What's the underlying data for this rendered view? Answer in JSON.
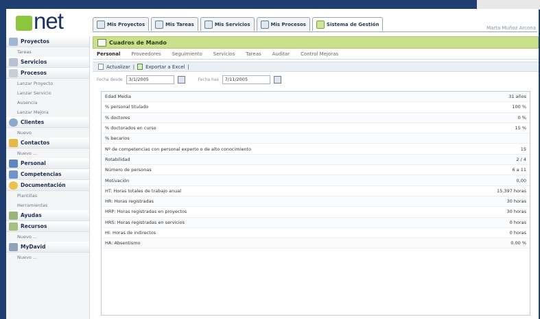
{
  "app": {
    "logo_text": "net",
    "user": "Marta Muñoz Arcona"
  },
  "tabs": [
    {
      "label": "Mis Proyectos"
    },
    {
      "label": "Mis Tareas"
    },
    {
      "label": "Mis Servicios"
    },
    {
      "label": "Mis Procesos"
    },
    {
      "label": "Sistema de Gestión"
    }
  ],
  "sidebar": {
    "sections": [
      {
        "label": "Proyectos",
        "links": [
          "Tareas"
        ]
      },
      {
        "label": "Servicios",
        "links": []
      },
      {
        "label": "Procesos",
        "links": [
          "Lanzar Proyecto",
          "Lanzar Servicio",
          "Ausencia",
          "Lanzar Mejora"
        ]
      },
      {
        "label": "Clientes",
        "links": [
          "Nuevo"
        ]
      },
      {
        "label": "Contactos",
        "links": [
          "Nuevo ..."
        ]
      },
      {
        "label": "Personal",
        "links": []
      },
      {
        "label": "Competencias",
        "links": []
      },
      {
        "label": "Documentación",
        "links": [
          "Plantillas",
          "Herramientas"
        ]
      },
      {
        "label": "Ayudas",
        "links": []
      },
      {
        "label": "Recursos",
        "links": [
          "Nuevo ..."
        ]
      },
      {
        "label": "MyDavid",
        "links": [
          "Nuevo ..."
        ]
      }
    ]
  },
  "panel": {
    "title": "Cuadros de Mando"
  },
  "subtabs": [
    "Personal",
    "Proveedores",
    "Seguimiento",
    "Servicios",
    "Tareas",
    "Auditar",
    "Control Mejoras"
  ],
  "toolbar": {
    "refresh": "Actualizar",
    "separator": "|",
    "export": "Exportar a Excel"
  },
  "dates": {
    "from_label": "Fecha desde",
    "from_value": "3/1/2005",
    "to_label": "Fecha has",
    "to_value": "7/11/2005"
  },
  "kpis": [
    {
      "label": "Edad Media",
      "value": "31 años"
    },
    {
      "label": "% personal titulado",
      "value": "100 %"
    },
    {
      "label": "% doctores",
      "value": "0 %"
    },
    {
      "label": "% doctorados en curso",
      "value": "15 %"
    },
    {
      "label": "% becarios",
      "value": ""
    },
    {
      "label": "Nº de competencias con personal experto o de alto conocimiento",
      "value": "15"
    },
    {
      "label": "Rotabilidad",
      "value": "2 / 4"
    },
    {
      "label": "Número de personas",
      "value": "6 a 11"
    },
    {
      "label": "Motivación",
      "value": "0,00"
    },
    {
      "label": "HT: Horas totales de trabajo anual",
      "value": "15.397 horas"
    },
    {
      "label": "HR: Horas registradas",
      "value": "30 horas"
    },
    {
      "label": "HRP: Horas registradas en proyectos",
      "value": "30 horas"
    },
    {
      "label": "HRS: Horas registradas en servicios",
      "value": "0 horas"
    },
    {
      "label": "HI: Horas de indirectos",
      "value": "0 horas"
    },
    {
      "label": "HA: Absentismo",
      "value": "0.00 %"
    }
  ],
  "colors": {
    "background": "#1f3d6e",
    "accent_green": "#c9e18a",
    "brand_blue": "#1a3366",
    "logo_green": "#8cc63f"
  }
}
